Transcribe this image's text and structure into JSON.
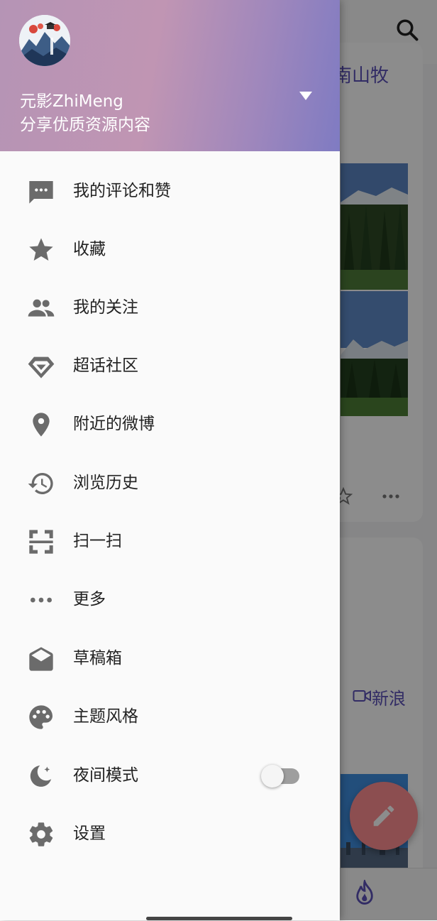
{
  "background_app": {
    "post_title": "南山牧",
    "video_source_label": "新浪"
  },
  "drawer": {
    "user_name": "元影ZhiMeng",
    "user_subtitle": "分享优质资源内容",
    "menu_items": [
      {
        "label": "我的评论和赞",
        "icon": "comment-icon"
      },
      {
        "label": "收藏",
        "icon": "star-icon"
      },
      {
        "label": "我的关注",
        "icon": "people-icon"
      },
      {
        "label": "超话社区",
        "icon": "diamond-icon"
      },
      {
        "label": "附近的微博",
        "icon": "location-pin-icon"
      },
      {
        "label": "浏览历史",
        "icon": "history-icon"
      },
      {
        "label": "扫一扫",
        "icon": "scan-icon"
      },
      {
        "label": "更多",
        "icon": "more-dots-icon"
      },
      {
        "label": "草稿箱",
        "icon": "drafts-icon"
      },
      {
        "label": "主题风格",
        "icon": "palette-icon"
      },
      {
        "label": "夜间模式",
        "icon": "night-mode-icon"
      },
      {
        "label": "设置",
        "icon": "gear-icon"
      }
    ],
    "night_mode_enabled": false
  },
  "colors": {
    "header_gradient_start": "#b594b5",
    "header_gradient_end": "#7f7bc2",
    "icon_gray": "#6b6b6b",
    "fab": "#ff8f92",
    "link_purple": "#5c51b8"
  }
}
